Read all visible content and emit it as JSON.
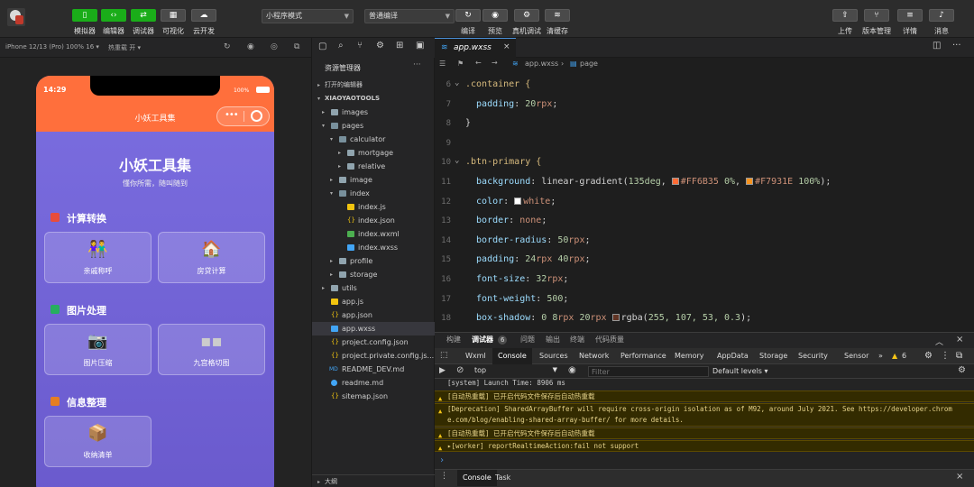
{
  "toolbar": {
    "left_buttons": [
      {
        "label": "模拟器",
        "icon": "phone-icon"
      },
      {
        "label": "编辑器",
        "icon": "code-icon"
      },
      {
        "label": "调试器",
        "icon": "debug-icon"
      },
      {
        "label": "可视化",
        "icon": "layout-icon"
      },
      {
        "label": "云开发",
        "icon": "cloud-icon"
      }
    ],
    "mode_select": "小程序模式",
    "compile_select": "普通编译",
    "mid_buttons": [
      {
        "label": "编译",
        "icon": "refresh-icon"
      },
      {
        "label": "预览",
        "icon": "eye-icon"
      },
      {
        "label": "真机调试",
        "icon": "bug-icon"
      },
      {
        "label": "清缓存",
        "icon": "layers-icon"
      }
    ],
    "right_buttons": [
      {
        "label": "上传",
        "icon": "upload-icon"
      },
      {
        "label": "版本管理",
        "icon": "branch-icon"
      },
      {
        "label": "详情",
        "icon": "menu-icon"
      },
      {
        "label": "消息",
        "icon": "bell-icon"
      }
    ]
  },
  "simulator": {
    "device": "iPhone 12/13 (Pro) 100% 16 ▾",
    "hot_reload": "热重载 开 ▾",
    "time": "14:29",
    "battery": "100%",
    "nav_title": "小妖工具集",
    "hero_title": "小妖工具集",
    "hero_subtitle": "懂你所需，随叫随到",
    "sections": [
      {
        "title": "计算转换",
        "icon_color": "#e74c3c",
        "cards": [
          {
            "label": "亲戚称呼",
            "emoji": "👫"
          },
          {
            "label": "房贷计算",
            "emoji": "🏠"
          }
        ]
      },
      {
        "title": "图片处理",
        "icon_color": "#27ae60",
        "cards": [
          {
            "label": "图片压缩",
            "emoji": "📷"
          },
          {
            "label": "九宫格切图",
            "emoji": "▪▪"
          }
        ]
      },
      {
        "title": "信息整理",
        "icon_color": "#e67e22",
        "cards": [
          {
            "label": "收纳清单",
            "emoji": "📦"
          }
        ]
      }
    ]
  },
  "explorer": {
    "title": "资源管理器",
    "open_editors": "打开的编辑器",
    "project": "XIAOYAOTOOLS",
    "outline": "大纲",
    "tree": [
      {
        "label": "images",
        "kind": "folder",
        "depth": 1,
        "twisty": "▸"
      },
      {
        "label": "pages",
        "kind": "folder-open",
        "depth": 1,
        "twisty": "▾"
      },
      {
        "label": "calculator",
        "kind": "folder-open",
        "depth": 2,
        "twisty": "▾"
      },
      {
        "label": "mortgage",
        "kind": "folder",
        "depth": 3,
        "twisty": "▸"
      },
      {
        "label": "relative",
        "kind": "folder",
        "depth": 3,
        "twisty": "▸"
      },
      {
        "label": "image",
        "kind": "folder",
        "depth": 2,
        "twisty": "▸"
      },
      {
        "label": "index",
        "kind": "folder-open",
        "depth": 2,
        "twisty": "▾"
      },
      {
        "label": "index.js",
        "kind": "js",
        "depth": 3,
        "twisty": ""
      },
      {
        "label": "index.json",
        "kind": "json",
        "depth": 3,
        "twisty": ""
      },
      {
        "label": "index.wxml",
        "kind": "wxml",
        "depth": 3,
        "twisty": ""
      },
      {
        "label": "index.wxss",
        "kind": "wxss",
        "depth": 3,
        "twisty": ""
      },
      {
        "label": "profile",
        "kind": "folder",
        "depth": 2,
        "twisty": "▸"
      },
      {
        "label": "storage",
        "kind": "folder",
        "depth": 2,
        "twisty": "▸"
      },
      {
        "label": "utils",
        "kind": "folder",
        "depth": 1,
        "twisty": "▸"
      },
      {
        "label": "app.js",
        "kind": "js",
        "depth": 1,
        "twisty": ""
      },
      {
        "label": "app.json",
        "kind": "json",
        "depth": 1,
        "twisty": ""
      },
      {
        "label": "app.wxss",
        "kind": "wxss",
        "depth": 1,
        "twisty": "",
        "selected": true
      },
      {
        "label": "project.config.json",
        "kind": "json",
        "depth": 1,
        "twisty": ""
      },
      {
        "label": "project.private.config.js...",
        "kind": "json",
        "depth": 1,
        "twisty": ""
      },
      {
        "label": "README_DEV.md",
        "kind": "md",
        "depth": 1,
        "twisty": ""
      },
      {
        "label": "readme.md",
        "kind": "info",
        "depth": 1,
        "twisty": ""
      },
      {
        "label": "sitemap.json",
        "kind": "json",
        "depth": 1,
        "twisty": ""
      }
    ]
  },
  "editor": {
    "tab": "app.wxss",
    "breadcrumb": [
      "app.wxss",
      "page"
    ],
    "lines": [
      {
        "n": "6",
        "fold": "⌄",
        "parts": [
          {
            "t": ".container {",
            "c": "k-sel"
          }
        ]
      },
      {
        "n": "7",
        "parts": [
          {
            "t": "  padding",
            "c": "k-prop"
          },
          {
            "t": ": ",
            "c": "k-plain"
          },
          {
            "t": "20",
            "c": "k-num"
          },
          {
            "t": "rpx",
            "c": "k-val"
          },
          {
            "t": ";",
            "c": "k-plain"
          }
        ]
      },
      {
        "n": "8",
        "parts": [
          {
            "t": "}",
            "c": "k-plain"
          }
        ]
      },
      {
        "n": "9",
        "parts": []
      },
      {
        "n": "10",
        "fold": "⌄",
        "parts": [
          {
            "t": ".btn-primary {",
            "c": "k-sel"
          }
        ]
      },
      {
        "n": "11",
        "parts": [
          {
            "t": "  background",
            "c": "k-prop"
          },
          {
            "t": ": linear-gradient(",
            "c": "k-plain"
          },
          {
            "t": "135deg",
            "c": "k-num"
          },
          {
            "t": ", ",
            "c": "k-plain"
          },
          {
            "sw": "#FF6B35"
          },
          {
            "t": "#FF6B35 ",
            "c": "k-val"
          },
          {
            "t": "0%",
            "c": "k-num"
          },
          {
            "t": ", ",
            "c": "k-plain"
          },
          {
            "sw": "#F7931E"
          },
          {
            "t": "#F7931E ",
            "c": "k-val"
          },
          {
            "t": "100%",
            "c": "k-num"
          },
          {
            "t": ");",
            "c": "k-plain"
          }
        ]
      },
      {
        "n": "12",
        "parts": [
          {
            "t": "  color",
            "c": "k-prop"
          },
          {
            "t": ": ",
            "c": "k-plain"
          },
          {
            "sw": "#ffffff"
          },
          {
            "t": "white",
            "c": "k-val"
          },
          {
            "t": ";",
            "c": "k-plain"
          }
        ]
      },
      {
        "n": "13",
        "parts": [
          {
            "t": "  border",
            "c": "k-prop"
          },
          {
            "t": ": ",
            "c": "k-plain"
          },
          {
            "t": "none",
            "c": "k-val"
          },
          {
            "t": ";",
            "c": "k-plain"
          }
        ]
      },
      {
        "n": "14",
        "parts": [
          {
            "t": "  border-radius",
            "c": "k-prop"
          },
          {
            "t": ": ",
            "c": "k-plain"
          },
          {
            "t": "50",
            "c": "k-num"
          },
          {
            "t": "rpx",
            "c": "k-val"
          },
          {
            "t": ";",
            "c": "k-plain"
          }
        ]
      },
      {
        "n": "15",
        "parts": [
          {
            "t": "  padding",
            "c": "k-prop"
          },
          {
            "t": ": ",
            "c": "k-plain"
          },
          {
            "t": "24",
            "c": "k-num"
          },
          {
            "t": "rpx ",
            "c": "k-val"
          },
          {
            "t": "40",
            "c": "k-num"
          },
          {
            "t": "rpx",
            "c": "k-val"
          },
          {
            "t": ";",
            "c": "k-plain"
          }
        ]
      },
      {
        "n": "16",
        "parts": [
          {
            "t": "  font-size",
            "c": "k-prop"
          },
          {
            "t": ": ",
            "c": "k-plain"
          },
          {
            "t": "32",
            "c": "k-num"
          },
          {
            "t": "rpx",
            "c": "k-val"
          },
          {
            "t": ";",
            "c": "k-plain"
          }
        ]
      },
      {
        "n": "17",
        "parts": [
          {
            "t": "  font-weight",
            "c": "k-prop"
          },
          {
            "t": ": ",
            "c": "k-plain"
          },
          {
            "t": "500",
            "c": "k-num"
          },
          {
            "t": ";",
            "c": "k-plain"
          }
        ]
      },
      {
        "n": "18",
        "parts": [
          {
            "t": "  box-shadow",
            "c": "k-prop"
          },
          {
            "t": ": ",
            "c": "k-plain"
          },
          {
            "t": "0 8",
            "c": "k-num"
          },
          {
            "t": "rpx ",
            "c": "k-val"
          },
          {
            "t": "20",
            "c": "k-num"
          },
          {
            "t": "rpx ",
            "c": "k-val"
          },
          {
            "sw": "rgba(255,107,53,0.3)"
          },
          {
            "t": "rgba(",
            "c": "k-plain"
          },
          {
            "t": "255, 107, 53, 0.3",
            "c": "k-num"
          },
          {
            "t": ");",
            "c": "k-plain"
          }
        ]
      }
    ]
  },
  "devtools": {
    "panel_tabs": [
      "构建",
      "调试器",
      "问题",
      "输出",
      "终端",
      "代码质量"
    ],
    "debugger_badge": "6",
    "tabs": [
      "Wxml",
      "Console",
      "Sources",
      "Network",
      "Performance",
      "Memory",
      "AppData",
      "Storage",
      "Security",
      "Sensor"
    ],
    "warn_count": "6",
    "context": "top",
    "filter_placeholder": "Filter",
    "levels": "Default levels ▾",
    "console_lines": [
      {
        "type": "log",
        "text": "[system] Launch Time: 8906 ms"
      },
      {
        "type": "warn",
        "text": "[自动热重载] 已开启代码文件保存后自动热重载"
      },
      {
        "type": "warn",
        "text": "[Deprecation] SharedArrayBuffer will require cross-origin isolation as of M92, around July 2021. See https://developer.chrom",
        "text2": "e.com/blog/enabling-shared-array-buffer/ for more details."
      },
      {
        "type": "warn",
        "text": "[自动热重载] 已开启代码文件保存后自动热重载"
      },
      {
        "type": "warn",
        "text": "▸[worker] reportRealtimeAction:fail not support"
      }
    ],
    "prompt": "›",
    "bottom_tabs": [
      "Console",
      "Task"
    ]
  },
  "colors": {
    "accent_green": "#1aad19",
    "nav_orange": "#ff6f3c",
    "hero_purple": "#6a5acd"
  }
}
